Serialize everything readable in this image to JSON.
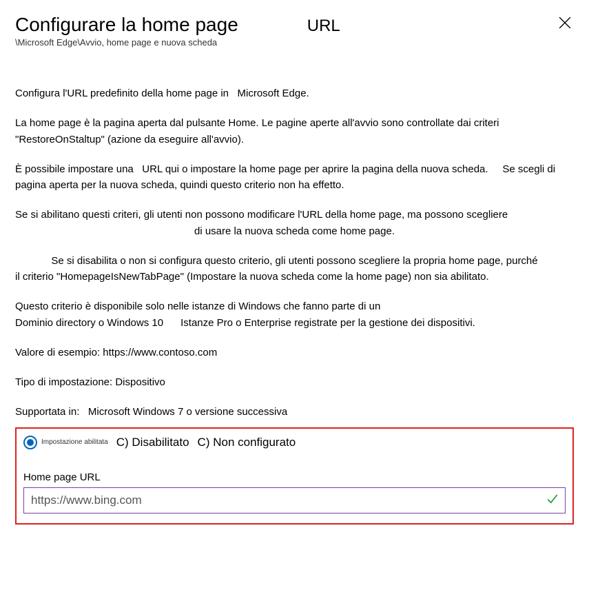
{
  "header": {
    "title": "Configurare la home page",
    "title_suffix": "URL",
    "breadcrumb": "\\Microsoft Edge\\Avvio, home page e nuova scheda"
  },
  "description": {
    "p1_a": "Configura l'URL predefinito della home page in ",
    "p1_b": "Microsoft Edge.",
    "p2": "La home page è la pagina aperta dal pulsante Home. Le pagine aperte all'avvio sono controllate dai criteri \"RestoreOnStaltup\" (azione da eseguire all'avvio).",
    "p3_a": "È possibile impostare una ",
    "p3_b": "URL qui o impostare la home page per aprire la pagina della nuova scheda.",
    "p3_c": "Se scegli di",
    "p3_d": "pagina aperta per la nuova scheda, quindi questo criterio non ha effetto.",
    "p4_a": "Se si abilitano questi criteri, gli utenti non possono modificare l'URL della home page, ma possono scegliere",
    "p4_b": "di usare la nuova scheda come home page.",
    "p5_a": "Se si disabilita o non si configura questo criterio, gli utenti possono scegliere la propria home page, purché",
    "p5_b": "il criterio \"HomepageIsNewTabPage\" (Impostare la nuova scheda come la home page) non sia abilitato.",
    "p6_a": "Questo criterio è disponibile solo nelle istanze di Windows che fanno parte di un",
    "p6_b": "Dominio directory o Windows 10",
    "p6_c": "Istanze Pro o Enterprise registrate per la gestione dei dispositivi.",
    "p7": "Valore di esempio: https://www.contoso.com",
    "p8": "Tipo di impostazione: Dispositivo",
    "p9_a": "Supportata in:",
    "p9_b": "Microsoft Windows 7 o versione successiva"
  },
  "settings": {
    "radios": {
      "enabled": "Impostazione abilitata",
      "disabled": "C) Disabilitato",
      "not_configured": "C) Non configurato"
    },
    "field_label": "Home page URL",
    "url_value": "https://www.bing.com"
  }
}
